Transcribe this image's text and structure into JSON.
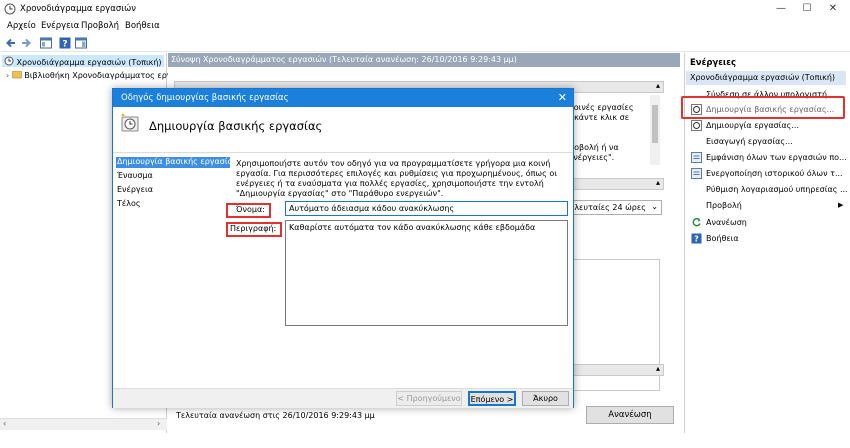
{
  "window": {
    "title": "Χρονοδιάγραμμα εργασιών",
    "controls": {
      "minimize": "—",
      "maximize": "☐",
      "close": "✕"
    }
  },
  "menu": [
    "Αρχείο",
    "Ενέργεια",
    "Προβολή",
    "Βοήθεια"
  ],
  "tree": {
    "root": "Χρονοδιάγραμμα εργασιών (Τοπική)",
    "child": "Βιβλιοθήκη Χρονοδιαγράμματος εργα"
  },
  "middle": {
    "header": "Σύνοψη Χρονοδιαγράμματος εργασιών (Τελευταία ανανέωση: 26/10/2016 9:29:43 μμ)",
    "behind_text_1": "κοινές εργασίες",
    "behind_text_2": ", κάντε κλικ σε",
    "behind_text_3": "ροβολή ή να",
    "behind_text_4": "ενέργειες\".",
    "dropdown_value": "ελευταίες 24 ώρες",
    "status": "Τελευταία ανανέωση στις 26/10/2016 9:29:43 μμ",
    "refresh_button": "Ανανέωση"
  },
  "actions": {
    "title": "Ενέργειες",
    "group": "Χρονοδιάγραμμα εργασιών (Τοπική)",
    "items": [
      "Σύνδεση σε άλλον υπολογιστή...",
      "Δημιουργία βασικής εργασίας...",
      "Δημιουργία εργασίας...",
      "Εισαγωγή εργασίας...",
      "Εμφάνιση όλων των εργασιών πο...",
      "Ενεργοποίηση ιστορικού όλων τ...",
      "Ρύθμιση λογαριασμού υπηρεσίας ...",
      "Προβολή",
      "Ανανέωση",
      "Βοήθεια"
    ]
  },
  "dialog": {
    "title": "Οδηγός δημιουργίας βασικής εργασίας",
    "heading": "Δημιουργία βασικής εργασίας",
    "nav": [
      "Δημιουργία βασικής εργασίας",
      "Έναυσμα",
      "Ενέργεια",
      "Τέλος"
    ],
    "intro": "Χρησιμοποιήστε αυτόν τον οδηγό για να προγραμματίσετε γρήγορα μια κοινή εργασία. Για περισσότερες επιλογές και ρυθμίσεις για προχωρημένους, όπως οι ενέργειες ή τα εναύσματα για πολλές εργασίες, χρησιμοποιήστε την εντολή \"Δημιουργία εργασίας\" στο \"Παράθυρο ενεργειών\".",
    "name_label": "Όνομα:",
    "name_value": "Αυτόματο άδειασμα κάδου ανακύκλωσης",
    "desc_label": "Περιγραφή:",
    "desc_value": "Καθαρίστε αυτόματα τον κάδο ανακύκλωσης κάθε εβδομάδα",
    "buttons": {
      "back": "< Προηγούμενο",
      "next": "Επόμενο >",
      "cancel": "Άκυρο"
    }
  },
  "colors": {
    "accent": "#1b7fdc",
    "highlight": "#e0322f",
    "selection": "#cce8ff",
    "headerbar": "#9aa7b8"
  }
}
